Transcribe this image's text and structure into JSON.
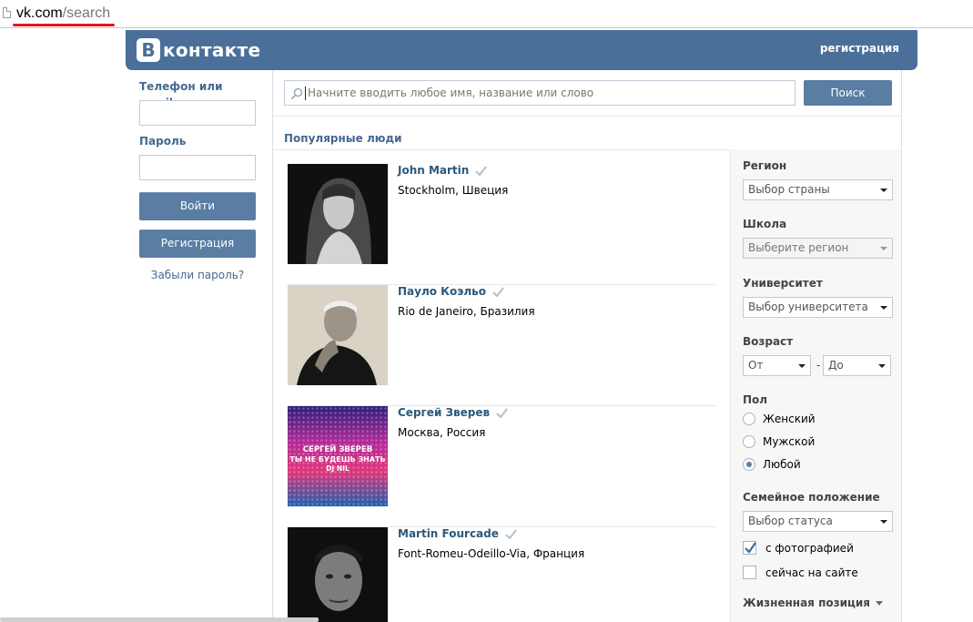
{
  "browser": {
    "url_host": "vk.com",
    "url_path": "/search"
  },
  "header": {
    "logo_letter": "B",
    "logo_text": "контакте",
    "register_link": "регистрация",
    "color": "#4a709a"
  },
  "login": {
    "phone_label": "Телефон или email",
    "phone_value": "",
    "password_label": "Пароль",
    "password_value": "",
    "login_button": "Войти",
    "register_button": "Регистрация",
    "forgot_link": "Забыли пароль?"
  },
  "search": {
    "placeholder": "Начните вводить любое имя, название или слово",
    "value": "",
    "button": "Поиск",
    "icon": "search-icon"
  },
  "popular": {
    "title": "Популярные люди",
    "people": [
      {
        "name": "John Martin",
        "location": "Stockholm, Швеция",
        "verified": true
      },
      {
        "name": "Пауло Коэльо",
        "location": "Rio de Janeiro, Бразилия",
        "verified": true
      },
      {
        "name": "Сергей Зверев",
        "location": "Москва, Россия",
        "verified": true,
        "cover_text": [
          "СЕРГЕЙ ЗВЕРЕВ",
          "ТЫ НЕ БУДЕШЬ ЗНАТЬ",
          "DJ NIL"
        ]
      },
      {
        "name": "Martin Fourcade",
        "location": "Font-Romeu-Odeillo-Via, Франция",
        "verified": true
      }
    ]
  },
  "filters": {
    "region_label": "Регион",
    "region_value": "Выбор страны",
    "school_label": "Школа",
    "school_value": "Выберите регион",
    "university_label": "Университет",
    "university_value": "Выбор университета",
    "age_label": "Возраст",
    "age_from": "От",
    "age_dash": "-",
    "age_to": "До",
    "gender_label": "Пол",
    "gender_options": [
      "Женский",
      "Мужской",
      "Любой"
    ],
    "gender_selected": "Любой",
    "marital_label": "Семейное положение",
    "marital_value": "Выбор статуса",
    "with_photo_label": "с фотографией",
    "with_photo_checked": true,
    "online_label": "сейчас на сайте",
    "online_checked": false,
    "more_label": "Жизненная позиция"
  }
}
